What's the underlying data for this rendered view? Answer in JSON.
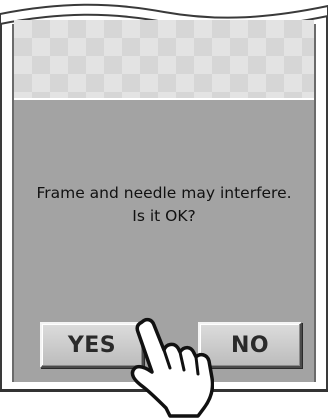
{
  "dialog": {
    "message_line1": "Frame and needle may interfere.",
    "message_line2": "Is it OK?"
  },
  "buttons": {
    "yes_label": "YES",
    "no_label": "NO"
  },
  "colors": {
    "dialog_background": "#a3a3a3",
    "pattern_light": "#e3e3e3",
    "pattern_dark": "#d6d6d6",
    "button_face": "#cccccc",
    "text": "#111111"
  },
  "icons": {
    "pointer": "pointing-hand-icon"
  }
}
